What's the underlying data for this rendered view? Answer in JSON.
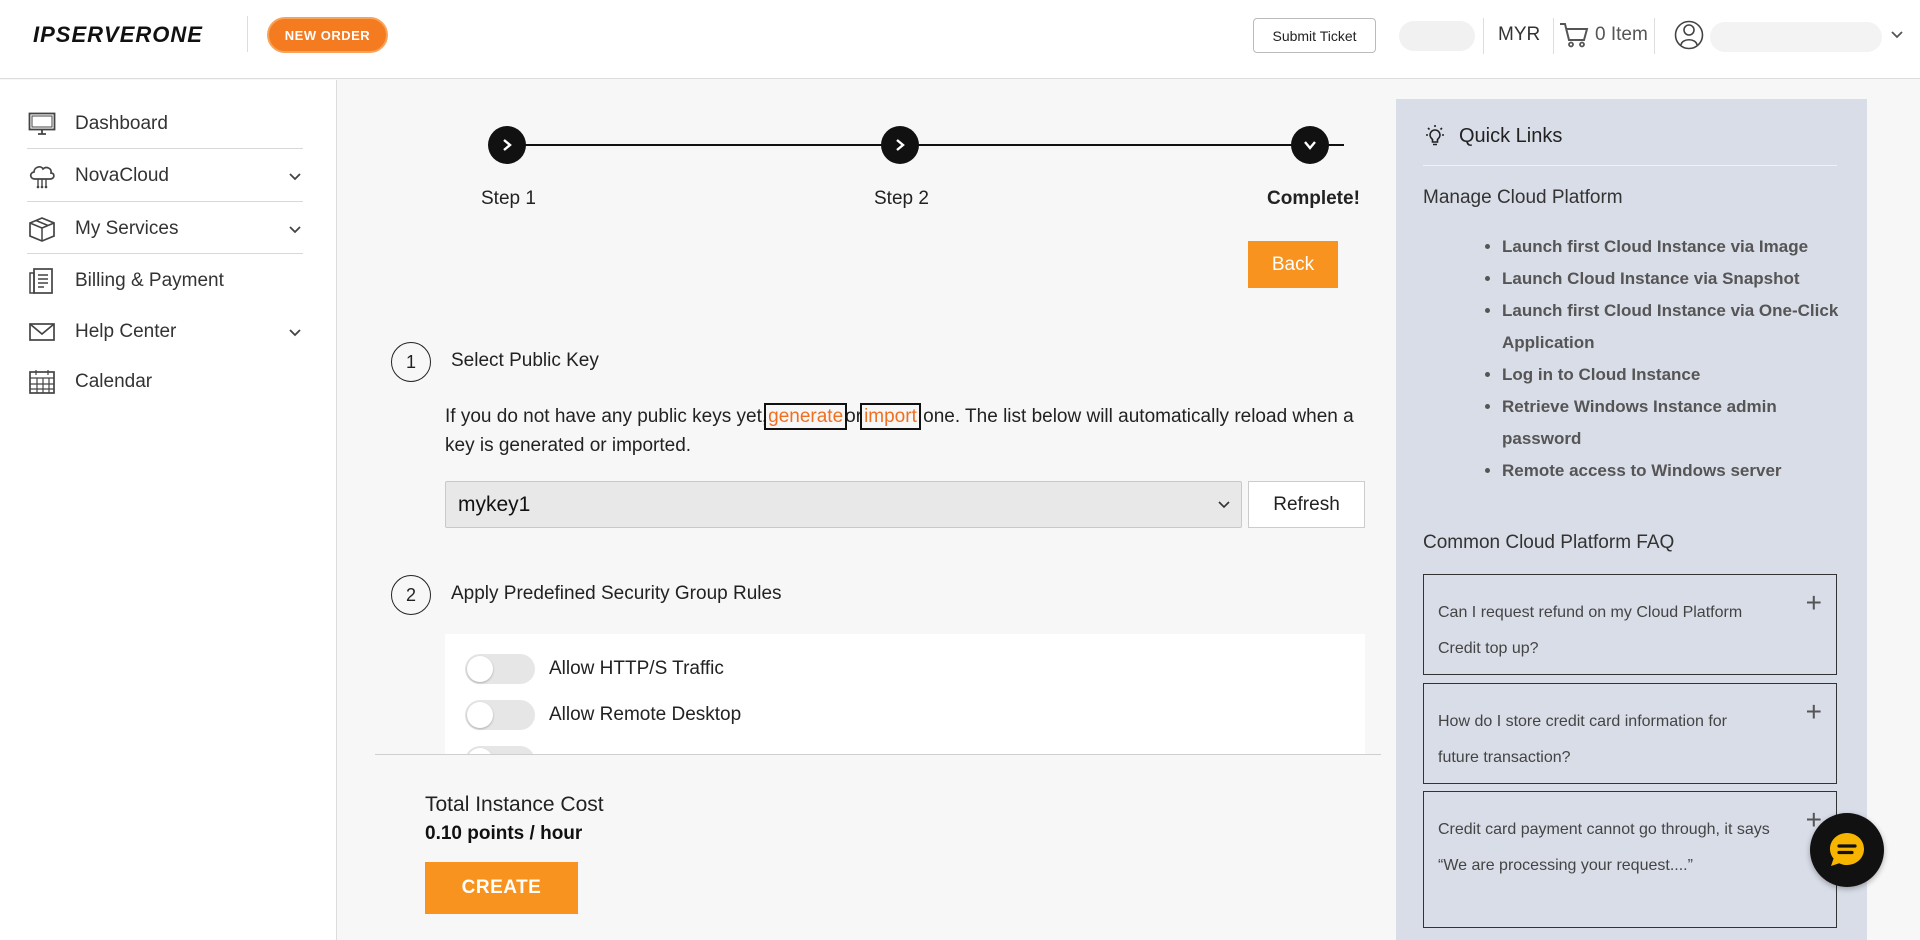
{
  "header": {
    "logo_text": "IPSERVERONE",
    "new_order_label": "NEW ORDER",
    "submit_ticket_label": "Submit Ticket",
    "currency": "MYR",
    "cart_label": "0 Item"
  },
  "sidebar": {
    "items": [
      {
        "label": "Dashboard",
        "icon": "monitor-icon"
      },
      {
        "label": "NovaCloud",
        "icon": "cloud-icon"
      },
      {
        "label": "My Services",
        "icon": "box-icon"
      },
      {
        "label": "Billing & Payment",
        "icon": "receipt-icon"
      },
      {
        "label": "Help Center",
        "icon": "envelope-icon"
      },
      {
        "label": "Calendar",
        "icon": "calendar-icon"
      }
    ]
  },
  "stepper": {
    "step1": "Step 1",
    "step2": "Step 2",
    "step3": "Complete!"
  },
  "back_label": "Back",
  "section1": {
    "number": "1",
    "title": "Select Public Key",
    "help_prefix": "If you do not have any public keys yet,",
    "generate_link": "generate",
    "or_text": "or",
    "import_link": "import",
    "help_suffix": " one. The list below will automatically reload when a key is generated or imported.",
    "selected_key": "mykey1",
    "refresh_label": "Refresh"
  },
  "section2": {
    "number": "2",
    "title": "Apply Predefined Security Group Rules",
    "rules": [
      {
        "label": "Allow HTTP/S Traffic",
        "enabled": false
      },
      {
        "label": "Allow Remote Desktop",
        "enabled": false
      }
    ]
  },
  "footer": {
    "cost_label": "Total Instance Cost",
    "cost_value": "0.10 points / hour",
    "create_label": "CREATE"
  },
  "quick_links": {
    "title": "Quick Links",
    "manage_heading": "Manage Cloud Platform",
    "links": [
      "Launch first Cloud Instance via Image",
      "Launch Cloud Instance via Snapshot",
      "Launch first Cloud Instance via One-Click Application",
      "Log in to Cloud Instance",
      "Retrieve Windows Instance admin password",
      "Remote access to Windows server"
    ],
    "faq_heading": "Common Cloud Platform FAQ",
    "faqs": [
      "Can I request refund on my Cloud Platform Credit top up?",
      "How do I store credit card information for future transaction?",
      "Credit card payment cannot go through, it says “We are processing your request....”"
    ]
  },
  "colors": {
    "accent_orange": "#f7931e",
    "link_orange": "#f07022",
    "panel_bg": "#d9dde8"
  }
}
